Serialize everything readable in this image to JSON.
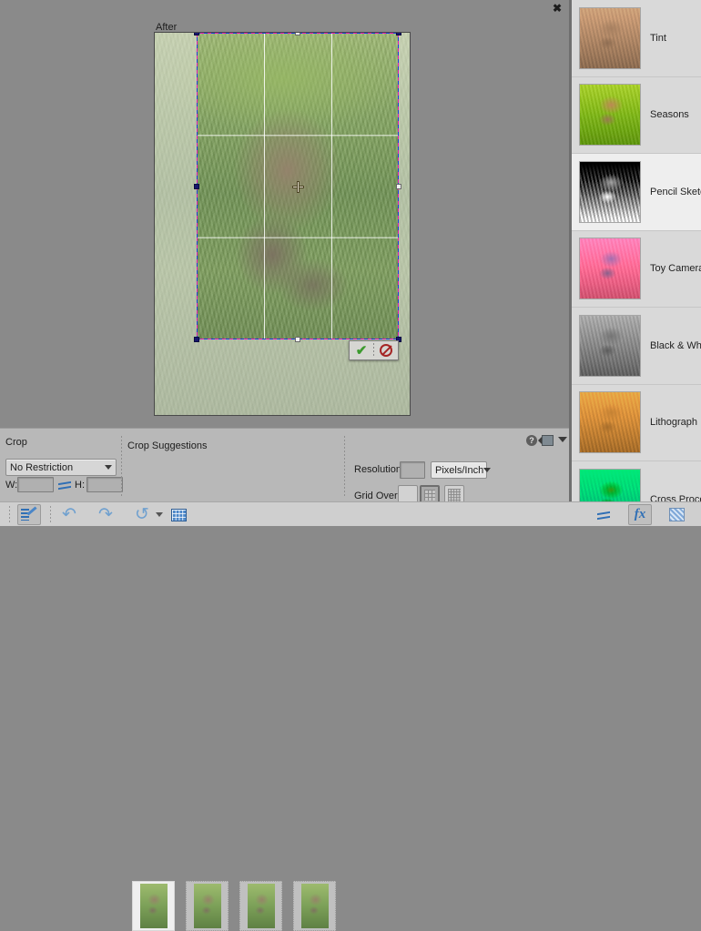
{
  "window": {
    "close_label": "✖"
  },
  "canvas": {
    "view_label": "After",
    "crop_actions": {
      "confirm_label": "✔",
      "cancel_label": "⃠"
    }
  },
  "effects_panel": {
    "items": [
      {
        "label": "Tint",
        "selected": false
      },
      {
        "label": "Seasons",
        "selected": false
      },
      {
        "label": "Pencil Sketch",
        "selected": true
      },
      {
        "label": "Toy Camera",
        "selected": false
      },
      {
        "label": "Black & White",
        "selected": false
      },
      {
        "label": "Lithograph",
        "selected": false
      },
      {
        "label": "Cross Process",
        "selected": false
      }
    ]
  },
  "options_bar": {
    "crop": {
      "title": "Crop",
      "restriction_value": "No Restriction",
      "width_label": "W:",
      "width_value": "",
      "height_label": "H:",
      "height_value": "",
      "swap_icon": "swap-dimensions-icon"
    },
    "suggestions": {
      "title": "Crop Suggestions",
      "count": 4
    },
    "settings": {
      "resolution_label": "Resolution:",
      "resolution_value": "",
      "resolution_unit": "Pixels/Inch",
      "grid_overlay_label": "Grid Overlay:",
      "grid_options": [
        "none",
        "rule-of-thirds",
        "fine-grid"
      ],
      "grid_selected_index": 1
    },
    "help_icon": "question-mark-icon",
    "panel_icon": "panel-bin-icon",
    "collapse_icon": "chevron-down-icon"
  },
  "toolbar": {
    "left_items": [
      {
        "name": "edit-quick-button",
        "icon": "edit-list-pencil-icon",
        "pressed": true
      },
      {
        "name": "undo-button",
        "icon": "undo-arrow-icon",
        "label": "↶"
      },
      {
        "name": "redo-button",
        "icon": "redo-arrow-icon",
        "label": "↷"
      },
      {
        "name": "reset-button",
        "icon": "reset-arrow-icon",
        "label": "↺"
      },
      {
        "name": "organizer-button",
        "icon": "grid-organizer-icon"
      }
    ],
    "right_items": [
      {
        "name": "adjustments-button",
        "icon": "sliders-icon"
      },
      {
        "name": "effects-button",
        "icon": "fx-icon",
        "label": "fx"
      },
      {
        "name": "textures-button",
        "icon": "textures-icon"
      }
    ]
  },
  "colors": {
    "app_bg": "#8a8a8a",
    "panel_bg": "#b8b8b8",
    "sidebar_bg": "#d9d9d9",
    "toolbar_bg": "#cfcfcf",
    "accent_blue": "#2f6fb5",
    "confirm_green": "#3c9a2e",
    "cancel_red": "#a52525"
  }
}
